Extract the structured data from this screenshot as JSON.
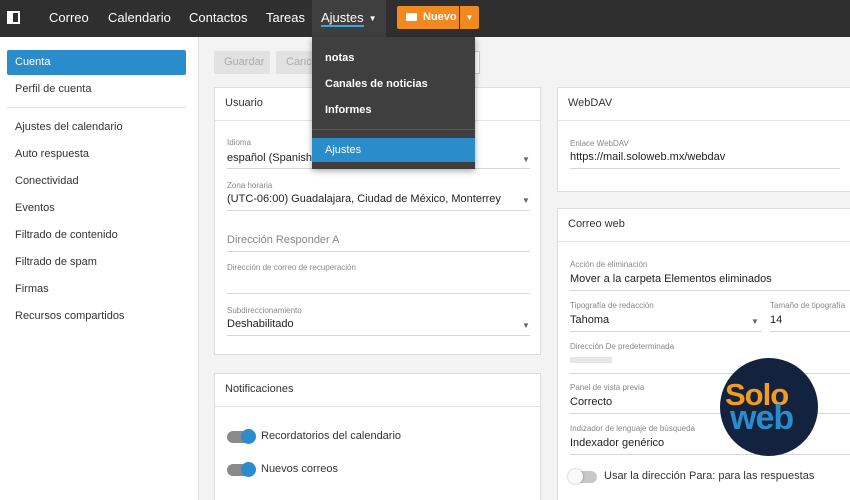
{
  "topnav": {
    "items": [
      "Correo",
      "Calendario",
      "Contactos",
      "Tareas"
    ],
    "active": "Ajustes",
    "new_button": "Nuevo"
  },
  "settings_menu": {
    "items": [
      "notas",
      "Canales de noticias",
      "Informes"
    ],
    "selected": "Ajustes"
  },
  "sidebar": {
    "items": [
      "Cuenta",
      "Perfil de cuenta",
      "Ajustes del calendario",
      "Auto respuesta",
      "Conectividad",
      "Eventos",
      "Filtrado de contenido",
      "Filtrado de spam",
      "Firmas",
      "Recursos compartidos"
    ]
  },
  "toolbar": {
    "save": "Guardar",
    "cancel": "Canc"
  },
  "usuario": {
    "title": "Usuario",
    "idioma_label": "Idioma",
    "idioma_value": "español (Spanish",
    "zona_label": "Zona horaria",
    "zona_value": "(UTC-06:00) Guadalajara, Ciudad de México, Monterrey",
    "reply_placeholder": "Dirección Responder A",
    "recovery_label": "Dirección de correo de recuperación",
    "sub_label": "Subdireccionamiento",
    "sub_value": "Deshabilitado"
  },
  "notificaciones": {
    "title": "Notificaciones",
    "toggle1": "Recordatorios del calendario",
    "toggle2": "Nuevos correos"
  },
  "webdav": {
    "title": "WebDAV",
    "link_label": "Enlace WebDAV",
    "link_value": "https://mail.soloweb.mx/webdav"
  },
  "correo_web": {
    "title": "Correo web",
    "delete_label": "Acción de eliminación",
    "delete_value": "Mover a la carpeta Elementos eliminados",
    "font_label": "Tipografía de redacción",
    "font_value": "Tahoma",
    "size_label": "Tamaño de tipografía",
    "size_value": "14",
    "from_label": "Dirección De predeterminada",
    "preview_label": "Panel de vista previa",
    "preview_value": "Correcto",
    "search_label": "Indizador de lenguaje de búsqueda",
    "search_value": "Indexador genérico",
    "reply_toggle": "Usar la dirección Para: para las respuestas"
  },
  "logo": {
    "line1": "Solo",
    "line2": "web",
    "orange": "#f39c1f",
    "blue": "#2b8ccb"
  },
  "colors": {
    "accent": "#2b8ccb",
    "new_button": "#f0891f",
    "topbar": "#2f2f2f"
  }
}
